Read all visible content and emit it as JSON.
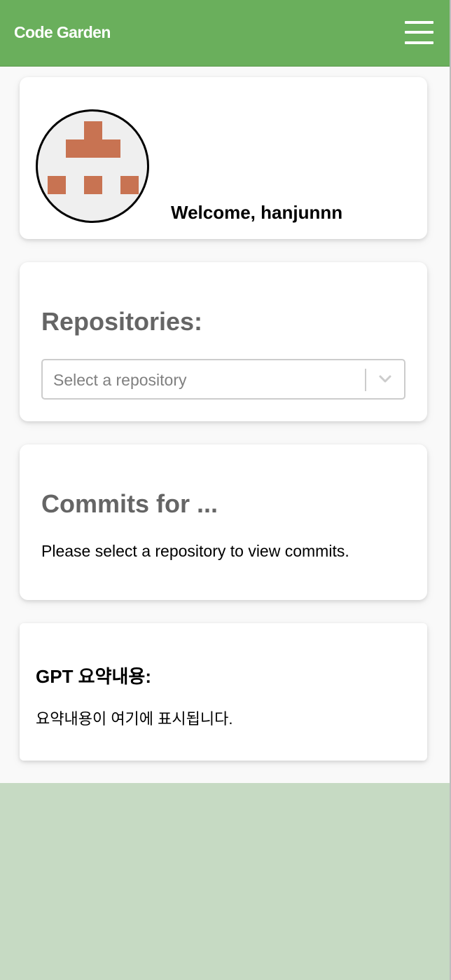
{
  "app": {
    "brand": "Code Garden",
    "menu_icon": "hamburger-menu-icon"
  },
  "profile": {
    "welcome": "Welcome, hanjunnn",
    "avatar_icon": "identicon-avatar",
    "avatar_color": "#c87352"
  },
  "repositories": {
    "heading": "Repositories:",
    "select": {
      "placeholder": "Select a repository",
      "icon": "chevron-down-icon"
    }
  },
  "commits": {
    "heading": "Commits for ...",
    "message": "Please select a repository to view commits."
  },
  "gpt": {
    "title": "GPT 요약내용:",
    "summary": "요약내용이 여기에 표시됩니다."
  },
  "colors": {
    "navbar": "#6aaf5c",
    "footer_area": "#c6dac3",
    "heading_gray": "#656565"
  }
}
